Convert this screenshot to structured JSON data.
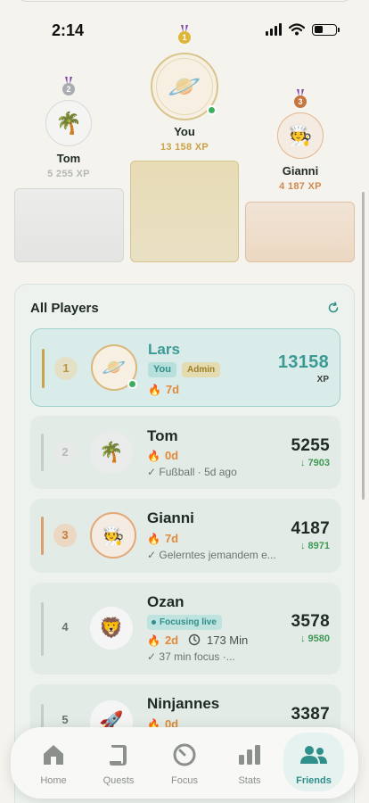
{
  "status_bar": {
    "time": "2:14"
  },
  "podium": {
    "first": {
      "name": "You",
      "xp": "13 158 XP",
      "medal": "1",
      "avatar": "saturn-icon"
    },
    "second": {
      "name": "Tom",
      "xp": "5 255 XP",
      "medal": "2",
      "avatar": "palm-tree-icon"
    },
    "third": {
      "name": "Gianni",
      "xp": "4 187 XP",
      "medal": "3",
      "avatar": "cook-icon"
    }
  },
  "players_card": {
    "title": "All Players",
    "rows": [
      {
        "rank": "1",
        "name": "Lars",
        "badge_you": "You",
        "badge_admin": "Admin",
        "streak": "7d",
        "xp": "13158",
        "xp_unit": "XP"
      },
      {
        "rank": "2",
        "name": "Tom",
        "streak": "0d",
        "activity": "✓ Fußball · 5d ago",
        "xp": "5255",
        "delta": "↓ 7903"
      },
      {
        "rank": "3",
        "name": "Gianni",
        "streak": "7d",
        "activity": "✓ Gelerntes jemandem e...",
        "xp": "4187",
        "delta": "↓ 8971"
      },
      {
        "rank": "4",
        "name": "Ozan",
        "live_badge": "Focusing live",
        "streak": "2d",
        "focus_minutes": "173 Min",
        "activity": "✓ 37 min focus ·...",
        "xp": "3578",
        "delta": "↓ 9580"
      },
      {
        "rank": "5",
        "name": "Ninjannes",
        "streak": "0d",
        "xp": "3387"
      }
    ]
  },
  "tabbar": {
    "tabs": [
      {
        "label": "Home",
        "icon": "home-icon"
      },
      {
        "label": "Quests",
        "icon": "scroll-icon"
      },
      {
        "label": "Focus",
        "icon": "timer-icon"
      },
      {
        "label": "Stats",
        "icon": "bar-chart-icon"
      },
      {
        "label": "Friends",
        "icon": "friends-icon",
        "active": true
      }
    ]
  },
  "colors": {
    "accent": "#2f8f8a",
    "gold": "#c9a24a",
    "streak": "#e08a3a",
    "delta": "#3f9a55"
  }
}
